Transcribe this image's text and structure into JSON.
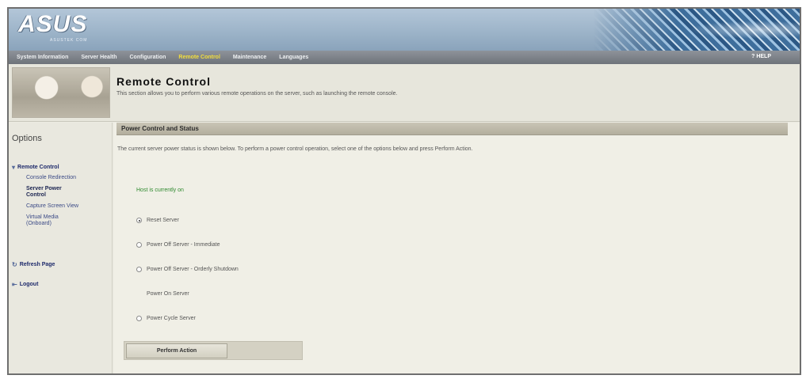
{
  "header": {
    "logo": "ASUS",
    "logo_sub": "ASUSTEK COM"
  },
  "nav": {
    "tabs": [
      {
        "label": "System Information"
      },
      {
        "label": "Server Health"
      },
      {
        "label": "Configuration"
      },
      {
        "label": "Remote Control"
      },
      {
        "label": "Maintenance"
      },
      {
        "label": "Languages"
      }
    ],
    "active_index": 3,
    "help": "? HELP"
  },
  "title": {
    "heading": "Remote Control",
    "description": "This section allows you to perform various remote operations on the server, such as launching the remote console."
  },
  "sidebar": {
    "title": "Options",
    "remote_control": "Remote Control",
    "items": [
      {
        "label": "Console Redirection"
      },
      {
        "label": "Server Power"
      },
      {
        "label": "Control"
      },
      {
        "label": "Capture Screen View"
      },
      {
        "label": "Virtual Media"
      },
      {
        "label": "(Onboard)"
      }
    ],
    "refresh": "Refresh Page",
    "logout": "Logout"
  },
  "main": {
    "section_title": "Power Control and Status",
    "intro": "The current server power status is shown below. To perform a power control operation, select one of the options below and press Perform Action.",
    "status": "Host is currently on",
    "options": [
      {
        "label": "Reset Server",
        "checked": true
      },
      {
        "label": "Power Off Server - Immediate",
        "checked": false
      },
      {
        "label": "Power Off Server - Orderly Shutdown",
        "checked": false
      },
      {
        "label": "Power On Server",
        "checked": false,
        "hidden_radio": true
      },
      {
        "label": "Power Cycle Server",
        "checked": false
      }
    ],
    "perform": "Perform Action"
  }
}
